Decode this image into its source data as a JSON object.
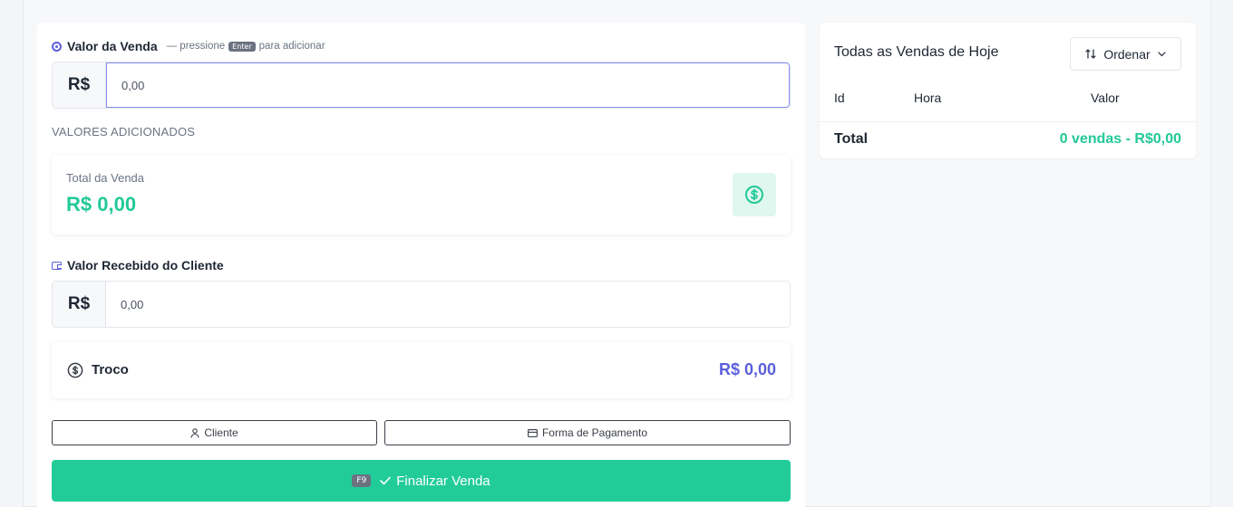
{
  "sale_value": {
    "label": "Valor da Venda",
    "hint_prefix": "— pressione",
    "hint_key": "Enter",
    "hint_suffix": "para adicionar",
    "currency": "R$",
    "value": "0,00"
  },
  "added_values_caption": "VALORES ADICIONADOS",
  "total_box": {
    "label": "Total da Venda",
    "value": "R$ 0,00"
  },
  "received": {
    "label": "Valor Recebido do Cliente",
    "currency": "R$",
    "value": "0,00"
  },
  "change": {
    "label": "Troco",
    "value": "R$ 0,00"
  },
  "buttons": {
    "client": "Cliente",
    "payment_method": "Forma de Pagamento",
    "finalize_key": "F9",
    "finalize": "Finalizar Venda"
  },
  "today_sales": {
    "title": "Todas as Vendas de Hoje",
    "sort_label": "Ordenar",
    "columns": [
      "Id",
      "Hora",
      "Valor"
    ],
    "total_label": "Total",
    "total_value": "0 vendas - R$0,00"
  },
  "colors": {
    "accent_green": "#22cc99",
    "accent_purple": "#5b5fdc"
  },
  "icons": [
    "target-icon",
    "wallet-icon",
    "dollar-circle-icon",
    "coin-icon",
    "user-icon",
    "card-icon",
    "check-icon",
    "sort-icon",
    "chevron-down-icon"
  ]
}
